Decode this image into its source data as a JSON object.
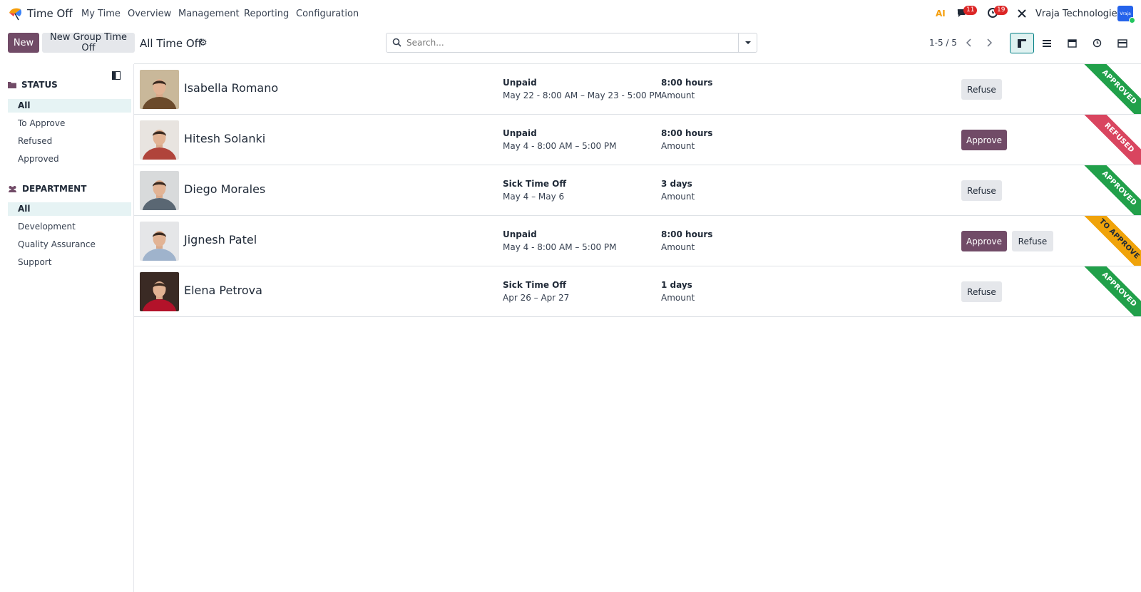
{
  "app": {
    "name": "Time Off"
  },
  "nav": [
    "My Time",
    "Overview",
    "Management",
    "Reporting",
    "Configuration"
  ],
  "systray": {
    "messages_count": "11",
    "activity_count": "19",
    "company": "Vraja Technologies",
    "user_initials": "Vraja"
  },
  "control": {
    "new_label": "New",
    "new_group_label": "New Group Time Off",
    "breadcrumb": "All Time Off",
    "search_placeholder": "Search...",
    "pager": "1-5 / 5"
  },
  "sidebar": {
    "status_title": "STATUS",
    "status_items": [
      "All",
      "To Approve",
      "Refused",
      "Approved"
    ],
    "department_title": "DEPARTMENT",
    "department_items": [
      "All",
      "Development",
      "Quality Assurance",
      "Support"
    ]
  },
  "records": [
    {
      "name": "Isabella Romano",
      "type": "Unpaid",
      "dates": "May 22 - 8:00 AM – May 23 - 5:00 PM",
      "duration": "8:00 hours",
      "amount_label": "Amount",
      "approve": "",
      "refuse": "Refuse",
      "status": "APPROVED",
      "status_key": "approved",
      "photo_bg": "#c9b89a",
      "photo_fg": "#6b4a2b"
    },
    {
      "name": "Hitesh Solanki",
      "type": "Unpaid",
      "dates": "May 4 - 8:00 AM – 5:00 PM",
      "duration": "8:00 hours",
      "amount_label": "Amount",
      "approve": "Approve",
      "refuse": "",
      "status": "REFUSED",
      "status_key": "refused",
      "photo_bg": "#e8e4e0",
      "photo_fg": "#b0443b"
    },
    {
      "name": "Diego Morales",
      "type": "Sick Time Off",
      "dates": "May 4 – May 6",
      "duration": "3 days",
      "amount_label": "Amount",
      "approve": "",
      "refuse": "Refuse",
      "status": "APPROVED",
      "status_key": "approved",
      "photo_bg": "#d8dadb",
      "photo_fg": "#5a6773"
    },
    {
      "name": "Jignesh Patel",
      "type": "Unpaid",
      "dates": "May 4 - 8:00 AM – 5:00 PM",
      "duration": "8:00 hours",
      "amount_label": "Amount",
      "approve": "Approve",
      "refuse": "Refuse",
      "status": "TO APPROVE",
      "status_key": "to-approve",
      "photo_bg": "#e5e6e8",
      "photo_fg": "#9fb3cc"
    },
    {
      "name": "Elena Petrova",
      "type": "Sick Time Off",
      "dates": "Apr 26 – Apr 27",
      "duration": "1 days",
      "amount_label": "Amount",
      "approve": "",
      "refuse": "Refuse",
      "status": "APPROVED",
      "status_key": "approved",
      "photo_bg": "#3a2a24",
      "photo_fg": "#b3122a"
    }
  ]
}
